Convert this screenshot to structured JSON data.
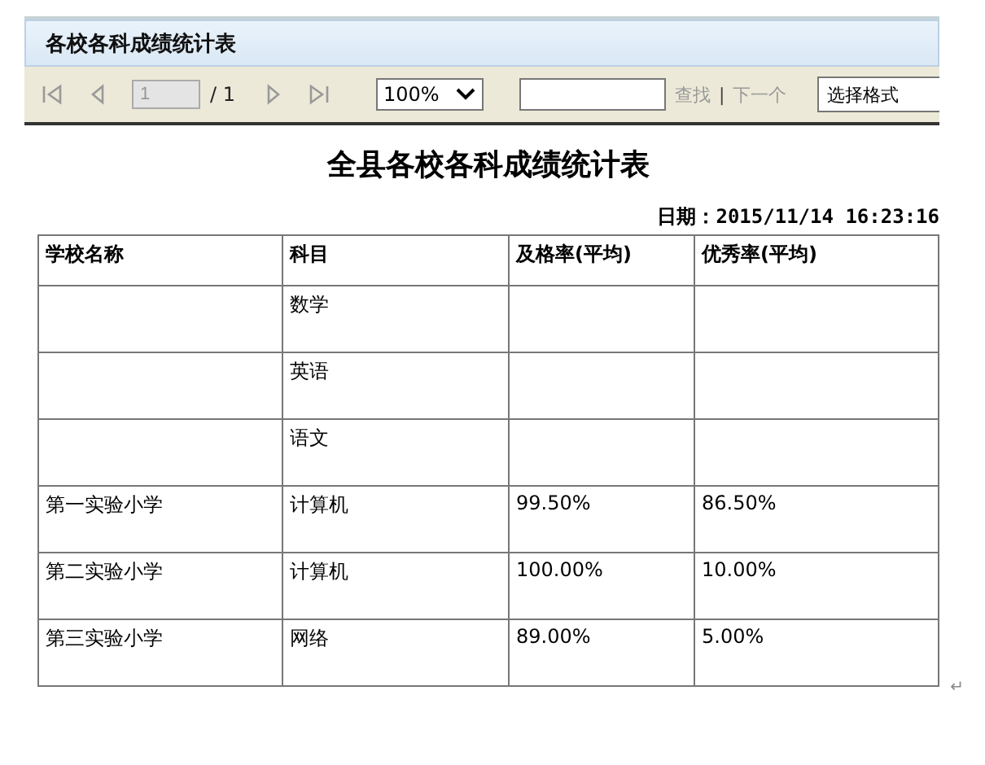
{
  "header": {
    "title": "各校各科成绩统计表"
  },
  "toolbar": {
    "page_value": "1",
    "page_total": "/ 1",
    "zoom": "100%",
    "find_label": "查找",
    "separator": "|",
    "next_label": "下一个",
    "format_select": "选择格式"
  },
  "report": {
    "title": "全县各校各科成绩统计表",
    "date": "日期：2015/11/14  16:23:16",
    "columns": [
      "学校名称",
      "科目",
      "及格率(平均)",
      "优秀率(平均)"
    ],
    "rows": [
      [
        "",
        "数学",
        "",
        ""
      ],
      [
        "",
        "英语",
        "",
        ""
      ],
      [
        "",
        "语文",
        "",
        ""
      ],
      [
        "第一实验小学",
        "计算机",
        "99.50%",
        "86.50%"
      ],
      [
        "第二实验小学",
        "计算机",
        "100.00%",
        "10.00%"
      ],
      [
        "第三实验小学",
        "网络",
        "89.00%",
        "5.00%"
      ]
    ],
    "end_mark": "↵"
  }
}
